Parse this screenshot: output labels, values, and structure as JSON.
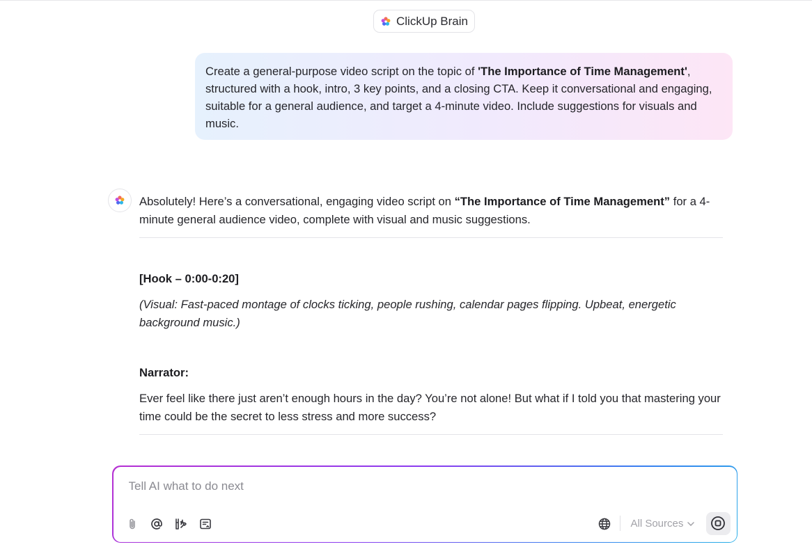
{
  "header": {
    "brand_label": "ClickUp Brain",
    "brand_icon": "clickup-brain-flower-icon"
  },
  "user_message": {
    "text_before": "Create a general-purpose video script on the topic of ",
    "bold_topic": "'The Importance of Time Management'",
    "text_after": ", structured with a hook, intro, 3 key points, and a closing CTA. Keep it conversational and engaging, suitable for a general audience, and target a 4-minute video. Include suggestions for visuals and music."
  },
  "ai_response": {
    "intro_before": "Absolutely! Here’s a conversational, engaging video script on ",
    "intro_bold": "“The Importance of Time Management”",
    "intro_after": " for a 4-minute general audience video, complete with visual and music suggestions.",
    "hook_heading": "[Hook – 0:00-0:20]",
    "visual_note": "(Visual: Fast-paced montage of clocks ticking, people rushing, calendar pages flipping. Upbeat, energetic background music.)",
    "narrator_heading": "Narrator:",
    "narrator_text": "Ever feel like there just aren’t enough hours in the day? You’re not alone! But what if I told you that mastering your time could be the secret to less stress and more success?"
  },
  "composer": {
    "placeholder": "Tell AI what to do next",
    "value": "",
    "sources_label": "All Sources",
    "tools": [
      "attach-icon",
      "mention-icon",
      "tools-icon",
      "notes-icon"
    ],
    "globe_icon": "globe-icon",
    "send_icon": "stop-icon"
  },
  "colors": {
    "gradient_start": "#b52fd2",
    "gradient_mid": "#8b3cf0",
    "gradient_end": "#28b0e8",
    "bubble_left": "#e6f1fd",
    "bubble_right": "#fde6f6"
  }
}
